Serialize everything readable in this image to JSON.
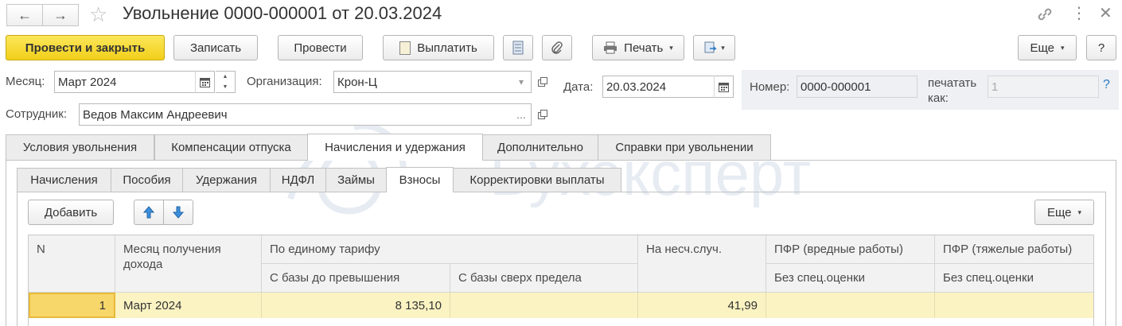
{
  "window": {
    "title": "Увольнение 0000-000001 от 20.03.2024",
    "icons": [
      "back-arrow-icon",
      "forward-arrow-icon",
      "star-icon",
      "link-icon",
      "more-vertical-icon",
      "close-icon"
    ]
  },
  "toolbar": {
    "post_close": "Провести и закрыть",
    "save": "Записать",
    "post": "Провести",
    "pay": "Выплатить",
    "print": "Печать",
    "more": "Еще",
    "help": "?"
  },
  "form": {
    "month_label": "Месяц:",
    "month_value": "Март 2024",
    "org_label": "Организация:",
    "org_value": "Крон-Ц",
    "date_label": "Дата:",
    "date_value": "20.03.2024",
    "number_label": "Номер:",
    "number_value": "0000-000001",
    "print_as_label_1": "печатать",
    "print_as_label_2": "как:",
    "print_as_value": "1",
    "help_q": "?",
    "employee_label": "Сотрудник:",
    "employee_value": "Ведов Максим Андреевич",
    "ellipsis": "..."
  },
  "tabs": [
    {
      "label": "Условия увольнения"
    },
    {
      "label": "Компенсации отпуска"
    },
    {
      "label": "Начисления и удержания"
    },
    {
      "label": "Дополнительно"
    },
    {
      "label": "Справки при увольнении"
    }
  ],
  "subtabs": [
    {
      "label": "Начисления"
    },
    {
      "label": "Пособия"
    },
    {
      "label": "Удержания"
    },
    {
      "label": "НДФЛ"
    },
    {
      "label": "Займы"
    },
    {
      "label": "Взносы"
    },
    {
      "label": "Корректировки выплаты"
    }
  ],
  "table_toolbar": {
    "add": "Добавить",
    "more": "Еще"
  },
  "table": {
    "headers": {
      "n": "N",
      "month": "Месяц получения дохода",
      "single_tariff": "По единому тарифу",
      "base_below": "С базы до превышения",
      "base_above": "С базы сверх предела",
      "accident": "На несч.случ.",
      "pfr_harmful": "ПФР (вредные работы)",
      "pfr_harmful_sub": "Без спец.оценки",
      "pfr_hard": "ПФР (тяжелые работы)",
      "pfr_hard_sub": "Без спец.оценки"
    },
    "rows": [
      {
        "n": "1",
        "month": "Март 2024",
        "base_below": "8 135,10",
        "base_above": "",
        "accident": "41,99",
        "pfr_harmful": "",
        "pfr_hard": ""
      }
    ]
  },
  "colors": {
    "primary_button": "#f2cf1a",
    "selected_row": "#fbf3c2",
    "active_cell": "#f7d66a",
    "accent_link": "#2b78c2"
  }
}
